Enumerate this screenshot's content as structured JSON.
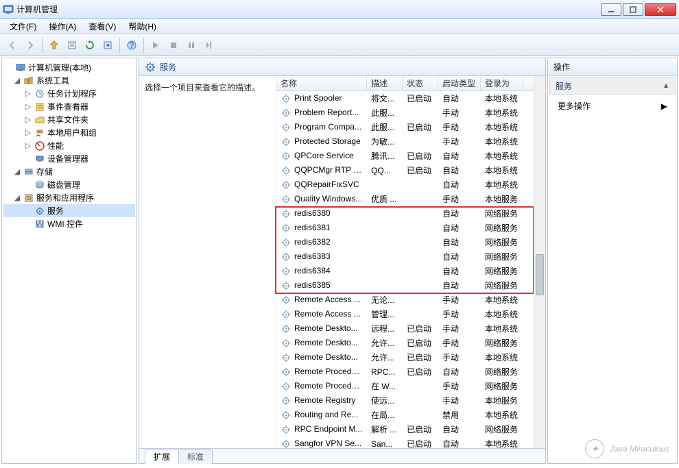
{
  "window": {
    "title": "计算机管理"
  },
  "menubar": {
    "file": "文件(F)",
    "action": "操作(A)",
    "view": "查看(V)",
    "help": "帮助(H)"
  },
  "tree": {
    "root": "计算机管理(本地)",
    "system_tools": "系统工具",
    "task_scheduler": "任务计划程序",
    "event_viewer": "事件查看器",
    "shared_folders": "共享文件夹",
    "local_users": "本地用户和组",
    "performance": "性能",
    "device_manager": "设备管理器",
    "storage": "存储",
    "disk_mgmt": "磁盘管理",
    "services_apps": "服务和应用程序",
    "services": "服务",
    "wmi": "WMI 控件"
  },
  "center": {
    "header": "服务",
    "desc_prompt": "选择一个项目来查看它的描述。",
    "columns": {
      "name": "名称",
      "desc": "描述",
      "state": "状态",
      "startup": "启动类型",
      "login": "登录为"
    },
    "tabs": {
      "extended": "扩展",
      "standard": "标准"
    }
  },
  "actions": {
    "header": "操作",
    "group": "服务",
    "more": "更多操作"
  },
  "services": [
    {
      "name": "Print Spooler",
      "desc": "将文...",
      "state": "已启动",
      "startup": "自动",
      "login": "本地系统"
    },
    {
      "name": "Problem Report...",
      "desc": "此服...",
      "state": "",
      "startup": "手动",
      "login": "本地系统"
    },
    {
      "name": "Program Compa...",
      "desc": "此服...",
      "state": "已启动",
      "startup": "手动",
      "login": "本地系统"
    },
    {
      "name": "Protected Storage",
      "desc": "为敏...",
      "state": "",
      "startup": "手动",
      "login": "本地系统"
    },
    {
      "name": "QPCore Service",
      "desc": "腾讯...",
      "state": "已启动",
      "startup": "自动",
      "login": "本地系统"
    },
    {
      "name": "QQPCMgr RTP S...",
      "desc": "QQ...",
      "state": "已启动",
      "startup": "自动",
      "login": "本地系统"
    },
    {
      "name": "QQRepairFixSVC",
      "desc": "",
      "state": "",
      "startup": "自动",
      "login": "本地系统"
    },
    {
      "name": "Quality Windows...",
      "desc": "优质 ...",
      "state": "",
      "startup": "手动",
      "login": "本地服务"
    },
    {
      "name": "redis6380",
      "desc": "",
      "state": "",
      "startup": "自动",
      "login": "网络服务"
    },
    {
      "name": "redis6381",
      "desc": "",
      "state": "",
      "startup": "自动",
      "login": "网络服务"
    },
    {
      "name": "redis6382",
      "desc": "",
      "state": "",
      "startup": "自动",
      "login": "网络服务"
    },
    {
      "name": "redis6383",
      "desc": "",
      "state": "",
      "startup": "自动",
      "login": "网络服务"
    },
    {
      "name": "redis6384",
      "desc": "",
      "state": "",
      "startup": "自动",
      "login": "网络服务"
    },
    {
      "name": "redis6385",
      "desc": "",
      "state": "",
      "startup": "自动",
      "login": "网络服务"
    },
    {
      "name": "Remote Access ...",
      "desc": "无论...",
      "state": "",
      "startup": "手动",
      "login": "本地系统"
    },
    {
      "name": "Remote Access ...",
      "desc": "管理...",
      "state": "",
      "startup": "手动",
      "login": "本地系统"
    },
    {
      "name": "Remote Deskto...",
      "desc": "远程...",
      "state": "已启动",
      "startup": "手动",
      "login": "本地系统"
    },
    {
      "name": "Remote Deskto...",
      "desc": "允许...",
      "state": "已启动",
      "startup": "手动",
      "login": "网络服务"
    },
    {
      "name": "Remote Deskto...",
      "desc": "允许...",
      "state": "已启动",
      "startup": "手动",
      "login": "本地系统"
    },
    {
      "name": "Remote Procedu...",
      "desc": "RPC...",
      "state": "已启动",
      "startup": "自动",
      "login": "网络服务"
    },
    {
      "name": "Remote Procedu...",
      "desc": "在 W...",
      "state": "",
      "startup": "手动",
      "login": "网络服务"
    },
    {
      "name": "Remote Registry",
      "desc": "使远...",
      "state": "",
      "startup": "手动",
      "login": "本地服务"
    },
    {
      "name": "Routing and Re...",
      "desc": "在局...",
      "state": "",
      "startup": "禁用",
      "login": "本地系统"
    },
    {
      "name": "RPC Endpoint M...",
      "desc": "解析 ...",
      "state": "已启动",
      "startup": "自动",
      "login": "网络服务"
    },
    {
      "name": "Sangfor VPN Se...",
      "desc": "San...",
      "state": "已启动",
      "startup": "自动",
      "login": "本地系统"
    }
  ],
  "watermark": "Java Miraculous"
}
